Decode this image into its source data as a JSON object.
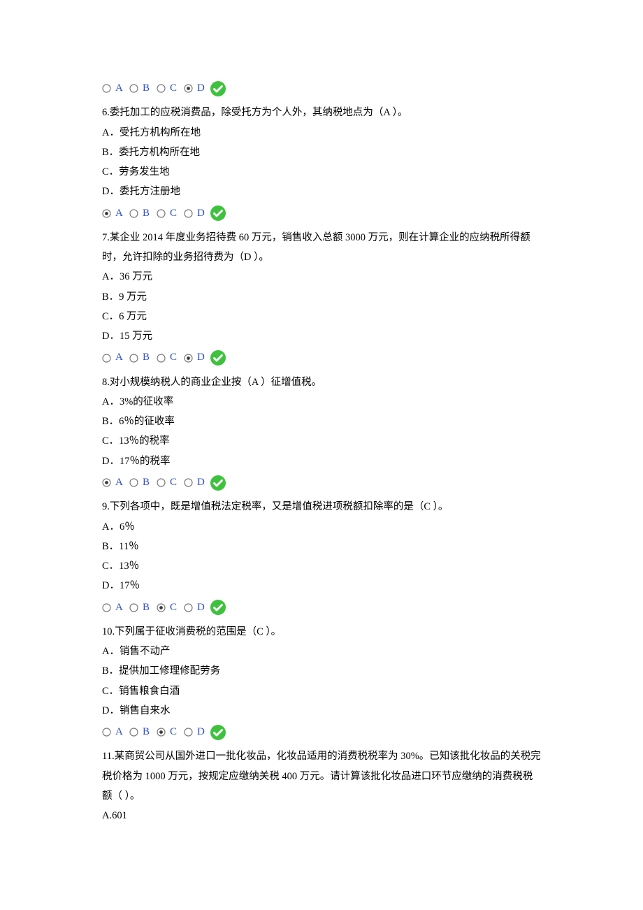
{
  "labels": {
    "A": "A",
    "B": "B",
    "C": "C",
    "D": "D"
  },
  "questions": [
    {
      "prev_answer_selected": "D",
      "num": "6",
      "stem": "6.委托加工的应税消费品，除受托方为个人外，其纳税地点为（A  ）。",
      "opts": [
        "A．受托方机构所在地",
        "B．委托方机构所在地",
        "C．劳务发生地",
        "D．委托方注册地"
      ],
      "selected": "A"
    },
    {
      "num": "7",
      "stem": "7.某企业 2014 年度业务招待费 60 万元，销售收入总额 3000 万元，则在计算企业的应纳税所得额时，允许扣除的业务招待费为（D  ）。",
      "opts": [
        "A．36 万元",
        "B．9 万元",
        "C．6 万元",
        "D．15 万元"
      ],
      "selected": "D"
    },
    {
      "num": "8",
      "stem": "8.对小规模纳税人的商业企业按（A  ）征增值税。",
      "opts": [
        "A．3%的征收率",
        "B．6％的征收率",
        "C．13％的税率",
        "D．17％的税率"
      ],
      "selected": "A"
    },
    {
      "num": "9",
      "stem": "9.下列各项中，既是增值税法定税率，又是增值税进项税额扣除率的是（C  ）。",
      "opts": [
        "A．6％",
        "B．11％",
        "C．13％",
        "D．17％"
      ],
      "selected": "C"
    },
    {
      "num": "10",
      "stem": "10.下列属于征收消费税的范围是（C  ）。",
      "opts": [
        "A．销售不动产",
        "B．提供加工修理修配劳务",
        "C．销售粮食白酒",
        "D．销售自来水"
      ],
      "selected": "C"
    },
    {
      "num": "11",
      "stem": "11.某商贸公司从国外进口一批化妆品，化妆品适用的消费税税率为 30%。已知该批化妆品的关税完税价格为 1000 万元，按规定应缴纳关税 400 万元。请计算该批化妆品进口环节应缴纳的消费税税额（  ）。",
      "opts": [
        "A.601"
      ]
    }
  ]
}
